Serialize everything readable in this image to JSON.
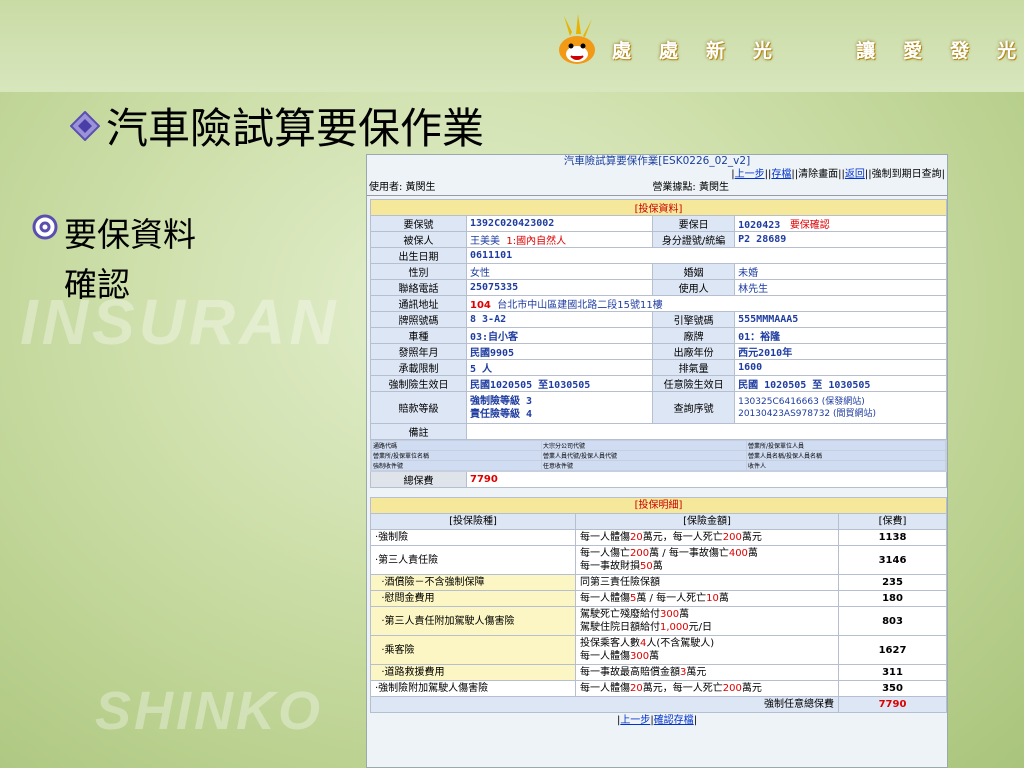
{
  "watermark": {
    "line1": "INSURAN",
    "line2": "SHINKO"
  },
  "slogan": [
    "處",
    "處",
    "新",
    "光",
    "讓",
    "愛",
    "發",
    "光"
  ],
  "slide": {
    "title": "汽車險試算要保作業",
    "bullet_label": "要保資料",
    "bullet_label2": "確認"
  },
  "window": {
    "header": "汽車險試算要保作業[ESK0226_02_v2]",
    "toolbar": {
      "prev": "上一步",
      "save": "存檔",
      "clear": "清除畫面",
      "back": "返回",
      "query": "強制到期日查詢"
    },
    "user_label": "使用者: 黃閔生",
    "office_label": "營業據點: 黃閔生",
    "section1": "[投保資料]",
    "rows": {
      "policy_no_l": "要保號",
      "policy_no": "1392C020423002",
      "apply_date_l": "要保日",
      "apply_date": "1020423",
      "apply_status": "要保確認",
      "insured_l": "被保人",
      "insured": "王美美",
      "insured_type": "1:國內自然人",
      "id_l": "身分證號/統編",
      "id_val": "P2      28689",
      "birth_l": "出生日期",
      "birth": "0611101",
      "gender_l": "性別",
      "gender": "女性",
      "marital_l": "婚姻",
      "marital": "未婚",
      "phone_l": "聯絡電話",
      "phone": "25075335",
      "user_l": "使用人",
      "user": "林先生",
      "addr_l": "通訊地址",
      "addr_zip": "104",
      "addr": "台北市中山區建國北路二段15號11樓",
      "plate_l": "牌照號碼",
      "plate": "8   3-A2",
      "engine_l": "引擎號碼",
      "engine": "555MMMAAA5",
      "type_l": "車種",
      "type": "03:自小客",
      "brand_l": "廠牌",
      "brand": "01：裕隆",
      "issue_l": "發照年月",
      "issue": "民國9905",
      "year_l": "出廠年份",
      "year": "西元2010年",
      "seat_l": "承載限制",
      "seat": "5  人",
      "cc_l": "排氣量",
      "cc": "1600",
      "cpl_l": "強制險生效日",
      "cpl": "民國1020505 至1030505",
      "vol_l": "任意險生效日",
      "vol": "民國 1020505 至 1030505",
      "grade_l": "賠款等級",
      "grade1": "強制險等級 3",
      "grade2": "責任險等級 4",
      "inq_l": "查詢序號",
      "inq1": "130325C6416663 (保發網站)",
      "inq2": "20130423AS978732 (間貿網站)",
      "note_l": "備註",
      "tiny": [
        "通路代碼",
        "大宗分公司代號",
        "營業所/投保單位人員",
        "營業所/投保單位名稱",
        "營業人員代號/投保人員代號",
        "營業人員名稱/投保人員名稱",
        "強制收件號",
        "任意收件號",
        "收件人"
      ],
      "premium_l": "總保費",
      "premium": "7790"
    },
    "section2": "[投保明細]",
    "detail_headers": [
      "[投保險種]",
      "[保險金額]",
      "[保費]"
    ],
    "details": [
      {
        "name": "‧強制險",
        "amt1": "每一人體傷20萬元，每一人死亡200萬元",
        "amt2": "",
        "fee": "1138",
        "hl": false
      },
      {
        "name": "‧第三人責任險",
        "amt1": "每一人傷亡200萬 / 每一事故傷亡400萬",
        "amt2": "每一事故財損50萬",
        "fee": "3146",
        "hl": false
      },
      {
        "name": "  ‧酒償險－不含強制保障",
        "amt1": "同第三責任險保額",
        "amt2": "",
        "fee": "235",
        "hl": true
      },
      {
        "name": "  ‧慰問金費用",
        "amt1": "每一人體傷5萬 / 每一人死亡10萬",
        "amt2": "",
        "fee": "180",
        "hl": true
      },
      {
        "name": "  ‧第三人責任附加駕駛人傷害險",
        "amt1": "駕駛死亡殘廢給付300萬",
        "amt2": "駕駛住院日額給付1,000元/日",
        "fee": "803",
        "hl": true
      },
      {
        "name": "  ‧乘客險",
        "amt1": "投保乘客人數4人(不含駕駛人)",
        "amt2": "每一人體傷300萬",
        "fee": "1627",
        "hl": true
      },
      {
        "name": "  ‧道路救援費用",
        "amt1": "每一事故最高賠償金額3萬元",
        "amt2": "",
        "fee": "311",
        "hl": true
      },
      {
        "name": "‧強制險附加駕駛人傷害險",
        "amt1": "每一人體傷20萬元，每一人死亡200萬元",
        "amt2": "",
        "fee": "350",
        "hl": false
      }
    ],
    "total_label": "強制任意總保費",
    "total": "7790",
    "footer": {
      "prev": "上一步",
      "confirm": "確認存檔"
    }
  }
}
